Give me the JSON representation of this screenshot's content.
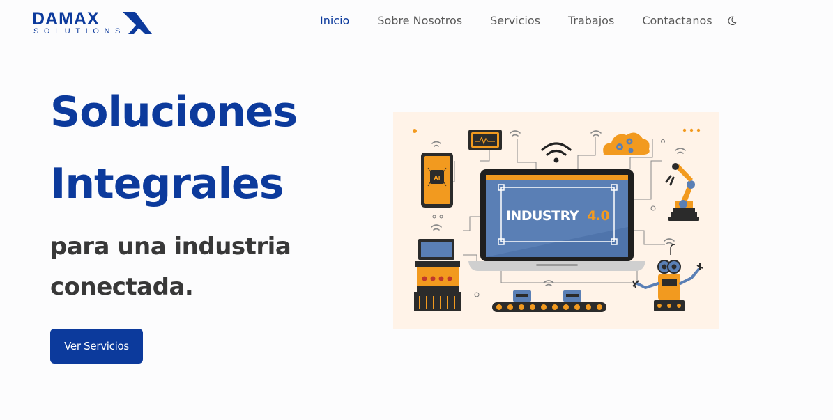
{
  "brand": {
    "name": "DAMAX",
    "tagline": "SOLUTIONS",
    "color": "#0c3a9c"
  },
  "nav": {
    "items": [
      {
        "label": "Inicio",
        "active": true
      },
      {
        "label": "Sobre Nosotros",
        "active": false
      },
      {
        "label": "Servicios",
        "active": false
      },
      {
        "label": "Trabajos",
        "active": false
      },
      {
        "label": "Contactanos",
        "active": false
      }
    ],
    "theme_toggle_icon": "moon-icon"
  },
  "hero": {
    "title_line1": "Soluciones",
    "title_line2": "Integrales",
    "subtitle_line1": "para una industria",
    "subtitle_line2": "conectada.",
    "cta_label": "Ver Servicios",
    "title_color": "#0c3a9c",
    "subtitle_color": "#383838"
  },
  "illustration": {
    "screen_text": "INDUSTRY",
    "screen_version": "4.0",
    "accent": "#f29a1f",
    "bg": "#fff3e8"
  }
}
